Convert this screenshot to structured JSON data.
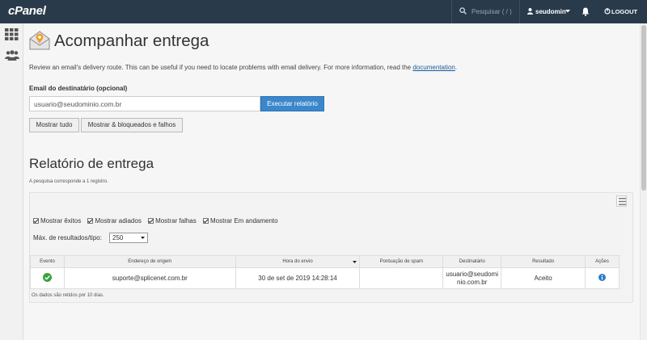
{
  "topbar": {
    "logo": "cPanel",
    "search_placeholder": "Pesquisar ( / )",
    "username": "seudomin",
    "logout_label": "LOGOUT"
  },
  "page": {
    "title": "Acompanhar entrega",
    "intro_text": "Review an email's delivery route. This can be useful if you need to locate problems with email delivery. For more information, read the",
    "intro_link": "documentation",
    "intro_end": "."
  },
  "form": {
    "recipient_label": "Email do destinatário (opcional)",
    "recipient_value": "usuario@seudominio.com.br",
    "run_button": "Executar relatório",
    "show_all_button": "Mostrar tudo",
    "show_blocked_button": "Mostrar & bloqueados e falhos"
  },
  "report": {
    "title": "Relatório de entrega",
    "count_text": "A pesquisa corresponde a 1 registro.",
    "filters": [
      {
        "label": "Mostrar êxitos",
        "checked": true
      },
      {
        "label": "Mostrar adiados",
        "checked": true
      },
      {
        "label": "Mostrar falhas",
        "checked": true
      },
      {
        "label": "Mostrar Em andamento",
        "checked": true
      }
    ],
    "max_label": "Máx. de resultados/tipo:",
    "max_value": "250",
    "columns": [
      "Evento",
      "Endereço de origem",
      "Hora do envio",
      "Pontuação de spam",
      "Destinatário",
      "Resultado",
      "Ações"
    ],
    "rows": [
      {
        "event_icon": "check-circle-icon",
        "origin": "suporte@splicenet.com.br",
        "sent_time": "30 de set de 2019 14:28:14",
        "spam_score": "",
        "recipient_line1": "usuario@seudomi",
        "recipient_line2": "nio.com.br",
        "result": "Aceito",
        "action_icon": "info-icon"
      }
    ],
    "retention_note": "Os dados são retidos por 10 dias."
  },
  "colors": {
    "topbar": "#293a4a",
    "primary_button": "#3a87cb",
    "success": "#3aa33a",
    "info": "#2f7ec7"
  }
}
